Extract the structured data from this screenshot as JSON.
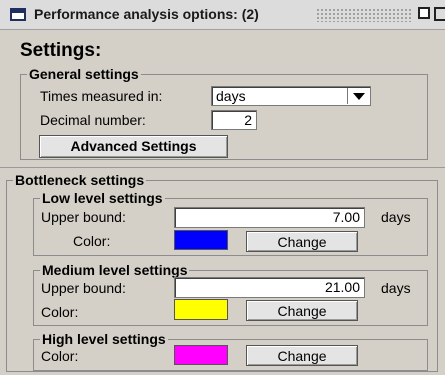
{
  "window": {
    "title": "Performance analysis options: (2)"
  },
  "settings": {
    "heading": "Settings:",
    "general": {
      "legend": "General settings",
      "times_label": "Times measured in:",
      "times_value": "days",
      "decimal_label": "Decimal number:",
      "decimal_value": "2",
      "advanced_button": "Advanced Settings"
    }
  },
  "bottleneck": {
    "legend": "Bottleneck settings",
    "low": {
      "legend": "Low level settings",
      "upper_label": "Upper bound:",
      "upper_value": "7.00",
      "unit": "days",
      "color_label": "Color:",
      "color": "#0000ff",
      "change_button": "Change"
    },
    "medium": {
      "legend": "Medium level settings",
      "upper_label": "Upper bound:",
      "upper_value": "21.00",
      "unit": "days",
      "color_label": "Color:",
      "color": "#ffff00",
      "change_button": "Change"
    },
    "high": {
      "legend": "High level settings",
      "color_label": "Color:",
      "color": "#ff00ff",
      "change_button": "Change"
    }
  }
}
